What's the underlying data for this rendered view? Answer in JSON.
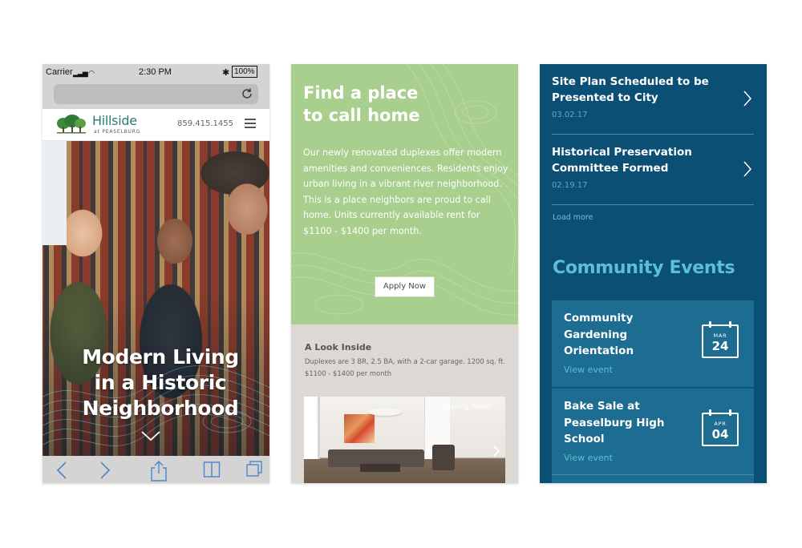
{
  "phone_screen": {
    "status": {
      "carrier": "Carrier",
      "time": "2:30 PM",
      "battery": "100%"
    },
    "site": {
      "logo_name": "Hillside",
      "logo_sub": "at PEASELBURG",
      "phone": "859.415.1455"
    },
    "hero": {
      "title_line1": "Modern Living",
      "title_line2": "in a Historic",
      "title_line3": "Neighborhood"
    }
  },
  "intro_screen": {
    "heading_line1": "Find a place",
    "heading_line2": "to call home",
    "body": "Our newly renovated duplexes offer modern amenities and conveniences. Residents enjoy urban living in a vibrant river neighborhood. This is a place neighbors are proud to call home. Units currently available rent for $1100 - $1400 per month.",
    "button_label": "Apply Now",
    "look_inside": {
      "title": "A Look Inside",
      "text": "Duplexes are 3 BR, 2.5 BA, with a 2-car garage. 1200 sq. ft. $1100 - $1400 per month",
      "gallery_label": "Living Room"
    }
  },
  "news_screen": {
    "news": [
      {
        "title": "Site Plan Scheduled to be Presented to City",
        "date": "03.02.17"
      },
      {
        "title": "Historical Preservation Committee Formed",
        "date": "02.19.17"
      }
    ],
    "load_more": "Load more",
    "events_title": "Community Events",
    "events": [
      {
        "title": "Community Gardening Orientation",
        "link": "View event",
        "month": "MAR",
        "day": "24"
      },
      {
        "title": "Bake Sale at Peaselburg High School",
        "link": "View event",
        "month": "APR",
        "day": "04"
      }
    ]
  },
  "colors": {
    "green_panel": "#a8cf8e",
    "blue_panel": "#0c4f74",
    "event_card": "#1d6c91",
    "accent_teal": "#5cc0d4",
    "logo_teal": "#2b7a7b"
  }
}
